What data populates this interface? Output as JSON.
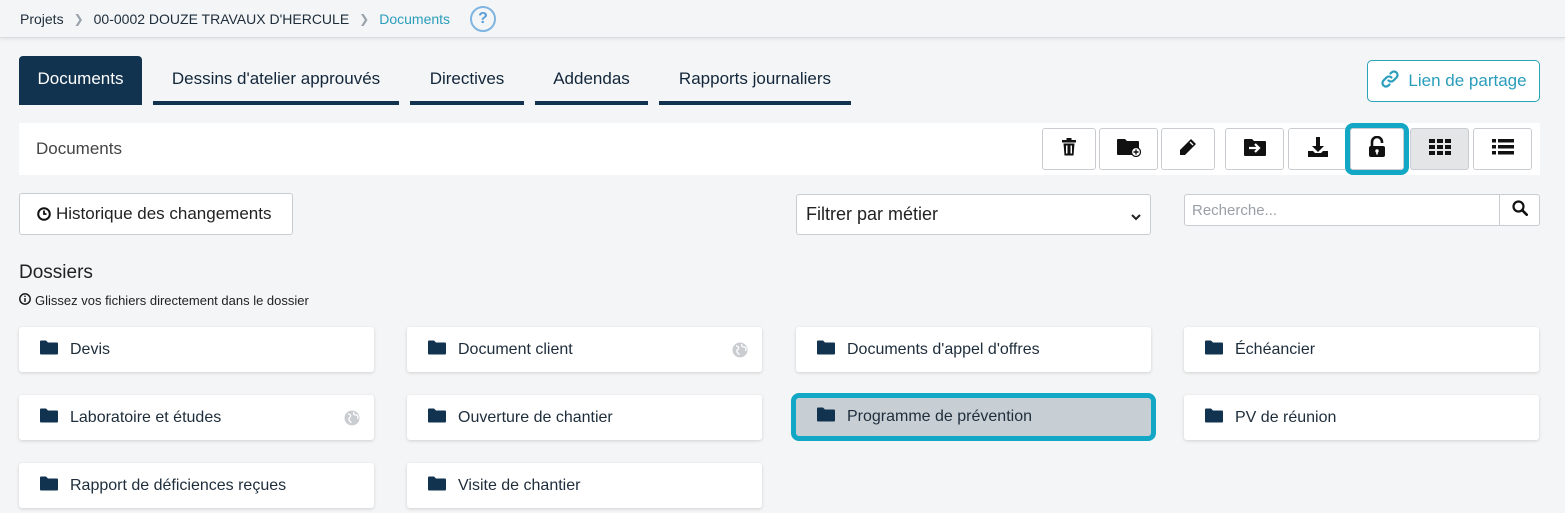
{
  "breadcrumb": {
    "items": [
      "Projets",
      "00-0002 DOUZE TRAVAUX D'HERCULE",
      "Documents"
    ],
    "help": "?"
  },
  "tabs": [
    {
      "label": "Documents",
      "active": true
    },
    {
      "label": "Dessins d'atelier approuvés",
      "active": false
    },
    {
      "label": "Directives",
      "active": false
    },
    {
      "label": "Addendas",
      "active": false
    },
    {
      "label": "Rapports journaliers",
      "active": false
    }
  ],
  "share": {
    "label": "Lien de partage",
    "icon": "link-icon"
  },
  "toolbar": {
    "title": "Documents",
    "tools": [
      "trash-icon",
      "new-folder-icon",
      "pencil-icon",
      "move-folder-icon",
      "download-icon",
      "unlock-icon",
      "grid-view-icon",
      "list-view-icon"
    ],
    "selected_view": "grid-view-icon"
  },
  "history": {
    "label": "Historique des changements",
    "icon": "clock-icon"
  },
  "filter": {
    "value": "Filtrer par métier"
  },
  "search": {
    "placeholder": "Recherche..."
  },
  "dossiers": {
    "title": "Dossiers",
    "hint": "Glissez vos fichiers directement dans le dossier",
    "folders": [
      {
        "name": "Devis",
        "shared": false
      },
      {
        "name": "Document client",
        "shared": true
      },
      {
        "name": "Documents d'appel d'offres",
        "shared": false
      },
      {
        "name": "Échéancier",
        "shared": false
      },
      {
        "name": "Laboratoire et études",
        "shared": true
      },
      {
        "name": "Ouverture de chantier",
        "shared": false
      },
      {
        "name": "Programme de prévention",
        "shared": false,
        "selected": true
      },
      {
        "name": "PV de réunion",
        "shared": false
      },
      {
        "name": "Rapport de déficiences reçues",
        "shared": false
      },
      {
        "name": "Visite de chantier",
        "shared": false
      }
    ]
  },
  "colors": {
    "navy": "#12334f",
    "accent": "#12a7c4",
    "link": "#2a9dbb"
  }
}
